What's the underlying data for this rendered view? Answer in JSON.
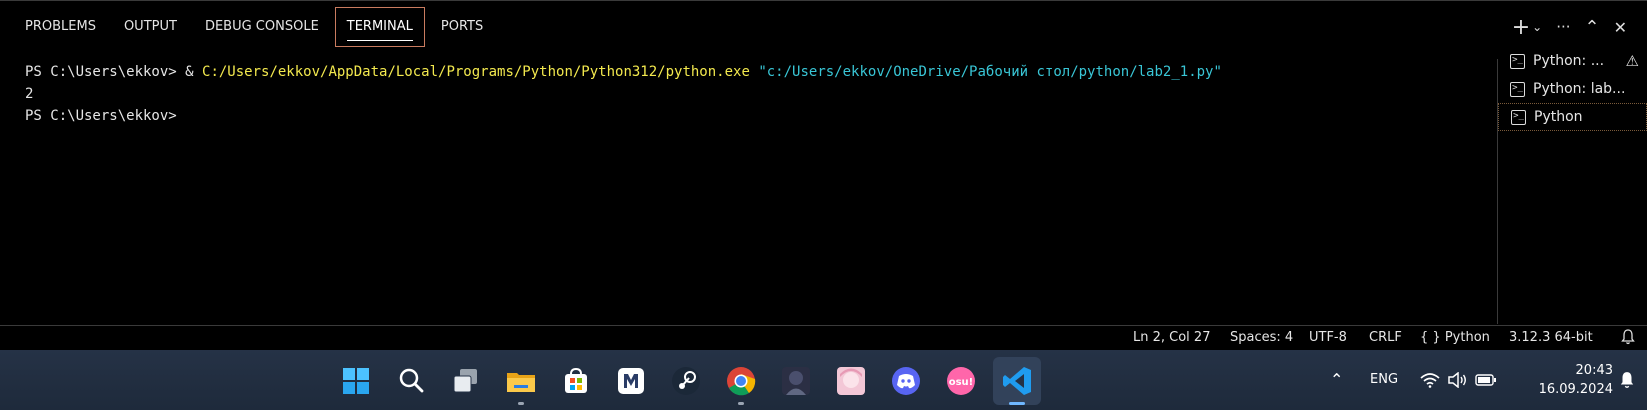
{
  "panel": {
    "tabs": [
      "PROBLEMS",
      "OUTPUT",
      "DEBUG CONSOLE",
      "TERMINAL",
      "PORTS"
    ],
    "active_tab": "TERMINAL",
    "actions": {
      "add": "+",
      "dropdown": "⌄",
      "more": "···",
      "maximize": "⌃",
      "close": "✕"
    }
  },
  "terminal": {
    "prompt1": "PS C:\\Users\\ekkov> ",
    "amp": "& ",
    "exe": "C:/Users/ekkov/AppData/Local/Programs/Python/Python312/python.exe",
    "script": "\"c:/Users/ekkov/OneDrive/Рабочий стол/python/lab2_1.py\"",
    "output": "2",
    "prompt2": "PS C:\\Users\\ekkov>"
  },
  "terminal_list": [
    {
      "label": "Python: ...",
      "warning": true
    },
    {
      "label": "Python: lab...",
      "warning": false
    },
    {
      "label": "Python",
      "warning": false
    }
  ],
  "status": {
    "position": "Ln 2, Col 27",
    "spaces": "Spaces: 4",
    "encoding": "UTF-8",
    "eol": "CRLF",
    "language": "Python",
    "language_icon": "{ }",
    "interpreter": "3.12.3 64-bit"
  },
  "taskbar": {
    "language": "ENG",
    "time": "20:43",
    "date": "16.09.2024",
    "apps": [
      "windows-start",
      "search",
      "task-view",
      "file-explorer",
      "microsoft-store",
      "mail",
      "steam",
      "chrome",
      "game-app",
      "anime-app",
      "discord",
      "osu",
      "vscode"
    ],
    "osu_label": "osu!"
  },
  "colors": {
    "path_yellow": "#f3e94e",
    "string_cyan": "#39c6d6",
    "vscode_blue": "#1f9cf0",
    "taskbar_bg": "#1e2a3b"
  }
}
